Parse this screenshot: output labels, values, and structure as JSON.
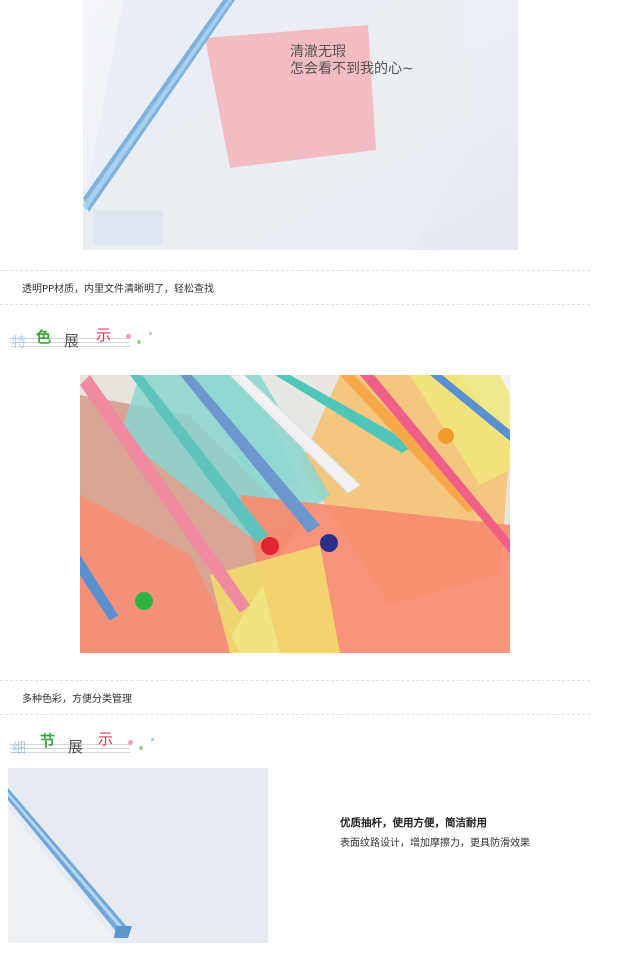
{
  "photo1": {
    "overlay_lines": [
      "清澈无瑕",
      "怎会看不到我的心~"
    ]
  },
  "caption1": "透明PP材质，内里文件清晰明了，轻松查找",
  "section_color": {
    "chars": [
      "特",
      "色",
      "展",
      "示"
    ],
    "colors": [
      "#7ab8e8",
      "#3aa63a",
      "#555555",
      "#e0355a"
    ]
  },
  "caption2": "多种色彩，方便分类管理",
  "section_detail": {
    "chars": [
      "细",
      "节",
      "展",
      "示"
    ],
    "colors": [
      "#7ab8e8",
      "#3aa63a",
      "#555555",
      "#e0355a"
    ]
  },
  "detail": {
    "title": "优质抽杆，使用方便，简洁耐用",
    "subtitle": "表面纹路设计，增加摩擦力，更具防滑效果"
  }
}
